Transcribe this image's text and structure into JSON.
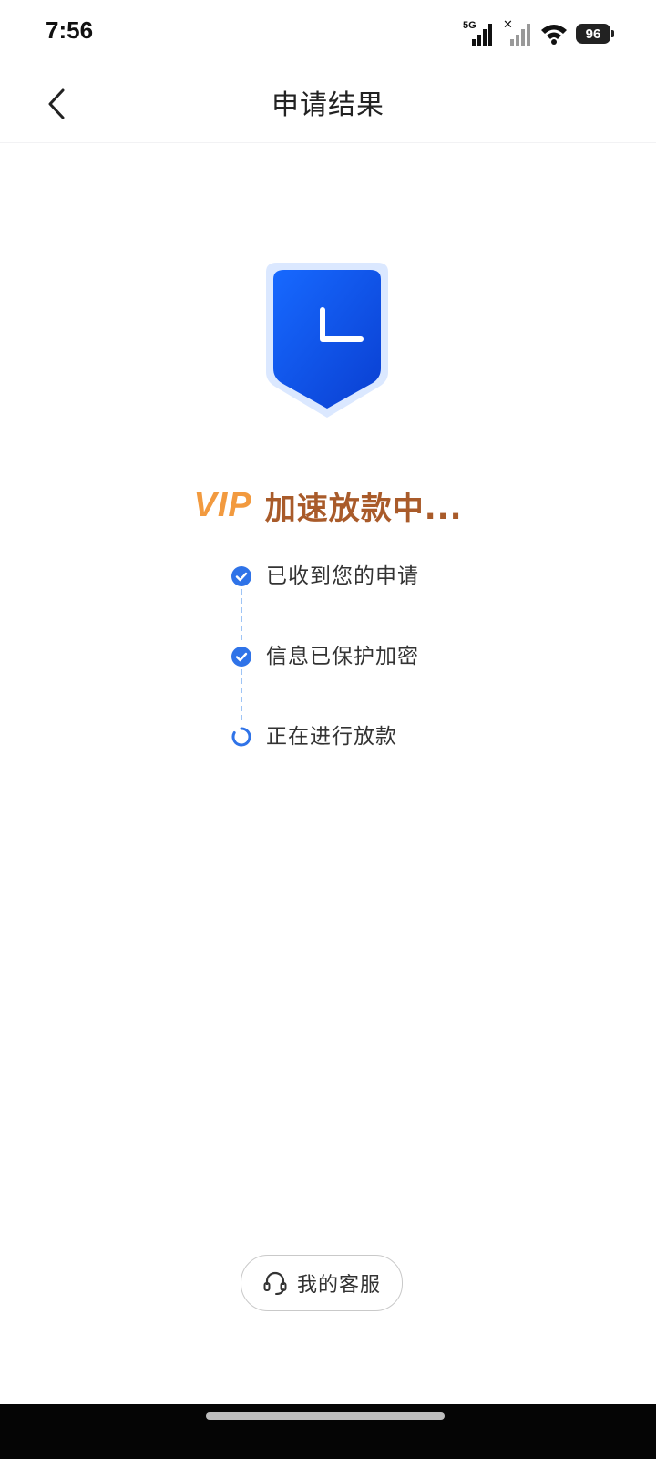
{
  "status_bar": {
    "time": "7:56",
    "network_label": "5G",
    "battery": "96",
    "icons": [
      "signal-5g-icon",
      "signal-no-sim-icon",
      "wifi-icon",
      "battery-icon"
    ]
  },
  "header": {
    "title": "申请结果",
    "back_icon": "chevron-left-icon"
  },
  "hero": {
    "icon": "shield-clock-icon",
    "badge": "VIP",
    "status": "加速放款中..."
  },
  "steps": [
    {
      "label": "已收到您的申请",
      "state": "done",
      "icon": "check-circle-icon"
    },
    {
      "label": "信息已保护加密",
      "state": "done",
      "icon": "check-circle-icon"
    },
    {
      "label": "正在进行放款",
      "state": "in-progress",
      "icon": "loading-circle-icon"
    }
  ],
  "footer": {
    "service_label": "我的客服",
    "service_icon": "headset-icon"
  },
  "colors": {
    "accent_blue": "#2f73e8",
    "vip_orange": "#f29a3f",
    "status_brown": "#a95b2a"
  }
}
